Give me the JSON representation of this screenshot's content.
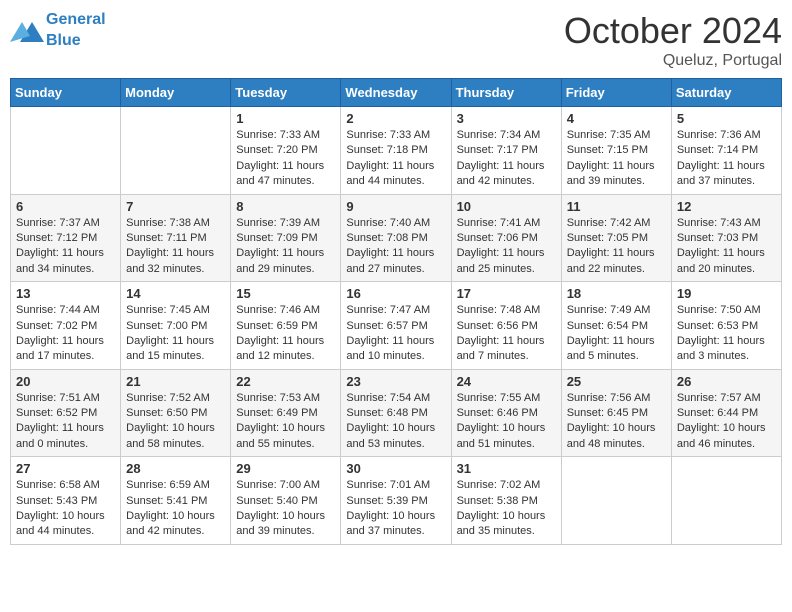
{
  "header": {
    "logo_line1": "General",
    "logo_line2": "Blue",
    "month": "October 2024",
    "location": "Queluz, Portugal"
  },
  "days_of_week": [
    "Sunday",
    "Monday",
    "Tuesday",
    "Wednesday",
    "Thursday",
    "Friday",
    "Saturday"
  ],
  "weeks": [
    [
      {
        "day": "",
        "content": ""
      },
      {
        "day": "",
        "content": ""
      },
      {
        "day": "1",
        "content": "Sunrise: 7:33 AM\nSunset: 7:20 PM\nDaylight: 11 hours and 47 minutes."
      },
      {
        "day": "2",
        "content": "Sunrise: 7:33 AM\nSunset: 7:18 PM\nDaylight: 11 hours and 44 minutes."
      },
      {
        "day": "3",
        "content": "Sunrise: 7:34 AM\nSunset: 7:17 PM\nDaylight: 11 hours and 42 minutes."
      },
      {
        "day": "4",
        "content": "Sunrise: 7:35 AM\nSunset: 7:15 PM\nDaylight: 11 hours and 39 minutes."
      },
      {
        "day": "5",
        "content": "Sunrise: 7:36 AM\nSunset: 7:14 PM\nDaylight: 11 hours and 37 minutes."
      }
    ],
    [
      {
        "day": "6",
        "content": "Sunrise: 7:37 AM\nSunset: 7:12 PM\nDaylight: 11 hours and 34 minutes."
      },
      {
        "day": "7",
        "content": "Sunrise: 7:38 AM\nSunset: 7:11 PM\nDaylight: 11 hours and 32 minutes."
      },
      {
        "day": "8",
        "content": "Sunrise: 7:39 AM\nSunset: 7:09 PM\nDaylight: 11 hours and 29 minutes."
      },
      {
        "day": "9",
        "content": "Sunrise: 7:40 AM\nSunset: 7:08 PM\nDaylight: 11 hours and 27 minutes."
      },
      {
        "day": "10",
        "content": "Sunrise: 7:41 AM\nSunset: 7:06 PM\nDaylight: 11 hours and 25 minutes."
      },
      {
        "day": "11",
        "content": "Sunrise: 7:42 AM\nSunset: 7:05 PM\nDaylight: 11 hours and 22 minutes."
      },
      {
        "day": "12",
        "content": "Sunrise: 7:43 AM\nSunset: 7:03 PM\nDaylight: 11 hours and 20 minutes."
      }
    ],
    [
      {
        "day": "13",
        "content": "Sunrise: 7:44 AM\nSunset: 7:02 PM\nDaylight: 11 hours and 17 minutes."
      },
      {
        "day": "14",
        "content": "Sunrise: 7:45 AM\nSunset: 7:00 PM\nDaylight: 11 hours and 15 minutes."
      },
      {
        "day": "15",
        "content": "Sunrise: 7:46 AM\nSunset: 6:59 PM\nDaylight: 11 hours and 12 minutes."
      },
      {
        "day": "16",
        "content": "Sunrise: 7:47 AM\nSunset: 6:57 PM\nDaylight: 11 hours and 10 minutes."
      },
      {
        "day": "17",
        "content": "Sunrise: 7:48 AM\nSunset: 6:56 PM\nDaylight: 11 hours and 7 minutes."
      },
      {
        "day": "18",
        "content": "Sunrise: 7:49 AM\nSunset: 6:54 PM\nDaylight: 11 hours and 5 minutes."
      },
      {
        "day": "19",
        "content": "Sunrise: 7:50 AM\nSunset: 6:53 PM\nDaylight: 11 hours and 3 minutes."
      }
    ],
    [
      {
        "day": "20",
        "content": "Sunrise: 7:51 AM\nSunset: 6:52 PM\nDaylight: 11 hours and 0 minutes."
      },
      {
        "day": "21",
        "content": "Sunrise: 7:52 AM\nSunset: 6:50 PM\nDaylight: 10 hours and 58 minutes."
      },
      {
        "day": "22",
        "content": "Sunrise: 7:53 AM\nSunset: 6:49 PM\nDaylight: 10 hours and 55 minutes."
      },
      {
        "day": "23",
        "content": "Sunrise: 7:54 AM\nSunset: 6:48 PM\nDaylight: 10 hours and 53 minutes."
      },
      {
        "day": "24",
        "content": "Sunrise: 7:55 AM\nSunset: 6:46 PM\nDaylight: 10 hours and 51 minutes."
      },
      {
        "day": "25",
        "content": "Sunrise: 7:56 AM\nSunset: 6:45 PM\nDaylight: 10 hours and 48 minutes."
      },
      {
        "day": "26",
        "content": "Sunrise: 7:57 AM\nSunset: 6:44 PM\nDaylight: 10 hours and 46 minutes."
      }
    ],
    [
      {
        "day": "27",
        "content": "Sunrise: 6:58 AM\nSunset: 5:43 PM\nDaylight: 10 hours and 44 minutes."
      },
      {
        "day": "28",
        "content": "Sunrise: 6:59 AM\nSunset: 5:41 PM\nDaylight: 10 hours and 42 minutes."
      },
      {
        "day": "29",
        "content": "Sunrise: 7:00 AM\nSunset: 5:40 PM\nDaylight: 10 hours and 39 minutes."
      },
      {
        "day": "30",
        "content": "Sunrise: 7:01 AM\nSunset: 5:39 PM\nDaylight: 10 hours and 37 minutes."
      },
      {
        "day": "31",
        "content": "Sunrise: 7:02 AM\nSunset: 5:38 PM\nDaylight: 10 hours and 35 minutes."
      },
      {
        "day": "",
        "content": ""
      },
      {
        "day": "",
        "content": ""
      }
    ]
  ]
}
